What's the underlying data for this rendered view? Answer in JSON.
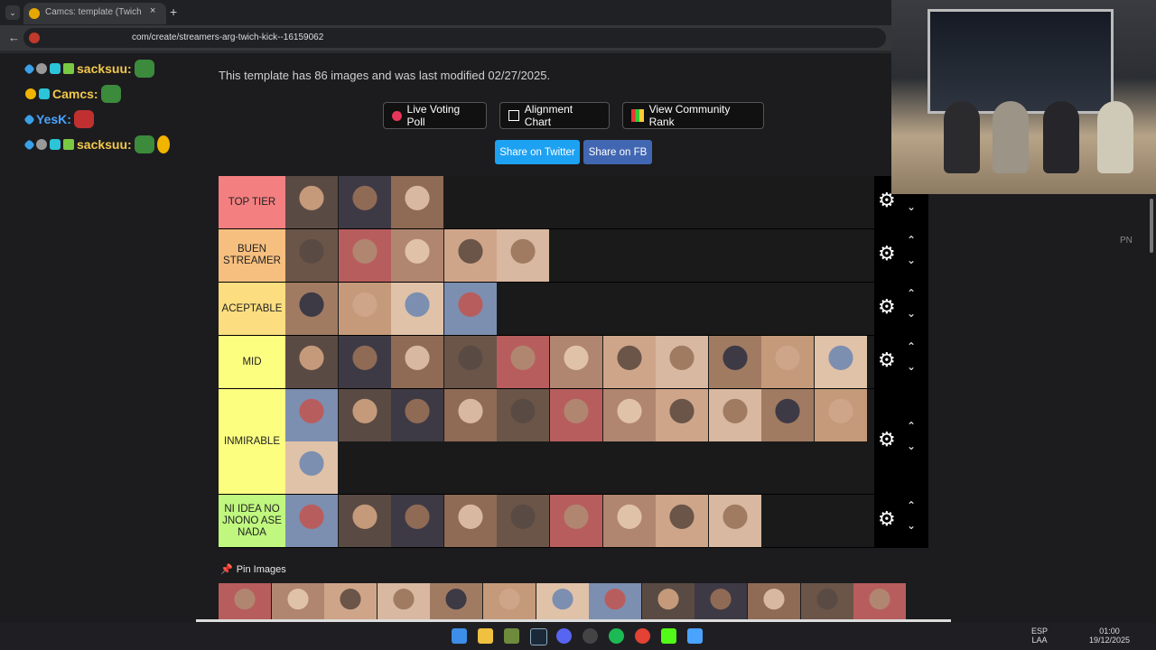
{
  "browser": {
    "tab_title": "Camcs: template (Twich",
    "url": "com/create/streamers-arg-twich-kick--16159062",
    "new_tab": "+",
    "close": "×",
    "back": "←",
    "menu": "⌄"
  },
  "chat": [
    {
      "user": "sacksuu:",
      "badges": [
        "blue",
        "grey",
        "cyan",
        "crown"
      ],
      "emotes": [
        "green"
      ]
    },
    {
      "user": "Camcs:",
      "badges": [
        "gold",
        "cyan"
      ],
      "emotes": [
        "green"
      ]
    },
    {
      "user": "YesK:",
      "badges": [
        "blue"
      ],
      "emotes": [
        "red"
      ]
    },
    {
      "user": "sacksuu:",
      "badges": [
        "blue",
        "grey",
        "cyan",
        "crown"
      ],
      "emotes": [
        "green",
        "hand"
      ]
    }
  ],
  "page": {
    "info": "This template has 86 images and was last modified 02/27/2025.",
    "buttons": {
      "poll": "Live Voting Poll",
      "align": "Alignment Chart",
      "rank": "View Community Rank",
      "twitter": "Share on Twitter",
      "fb": "Share on FB"
    },
    "pin_label": "Pin Images",
    "side_label": "PN"
  },
  "tiers": [
    {
      "label": "TOP TIER",
      "color": "#f47f80",
      "count": 3
    },
    {
      "label": "BUEN STREAMER",
      "color": "#f7bf7f",
      "count": 5
    },
    {
      "label": "ACEPTABLE",
      "color": "#fcde80",
      "count": 4
    },
    {
      "label": "MID",
      "color": "#fcfe80",
      "count": 11
    },
    {
      "label": "INMIRABLE",
      "color": "#fcfe80",
      "count": 12
    },
    {
      "label": "NI IDEA NO JNONO ASE NADA",
      "color": "#bff77f",
      "count": 9
    }
  ],
  "tier_controls": {
    "gear": "⚙",
    "up": "⌃",
    "down": "⌄"
  },
  "pin_images_count": 13,
  "face_palette": [
    "#c49a7a",
    "#8f6a55",
    "#d8b8a0",
    "#5a4a44",
    "#b08670",
    "#e0c2a8",
    "#6a5548",
    "#a07b62",
    "#3d3a45",
    "#cfa58a",
    "#7c8fb0",
    "#b85d5d"
  ],
  "taskbar": {
    "lang_top": "ESP",
    "lang_bottom": "LAA",
    "time": "01:00",
    "date": "19/12/2025"
  }
}
